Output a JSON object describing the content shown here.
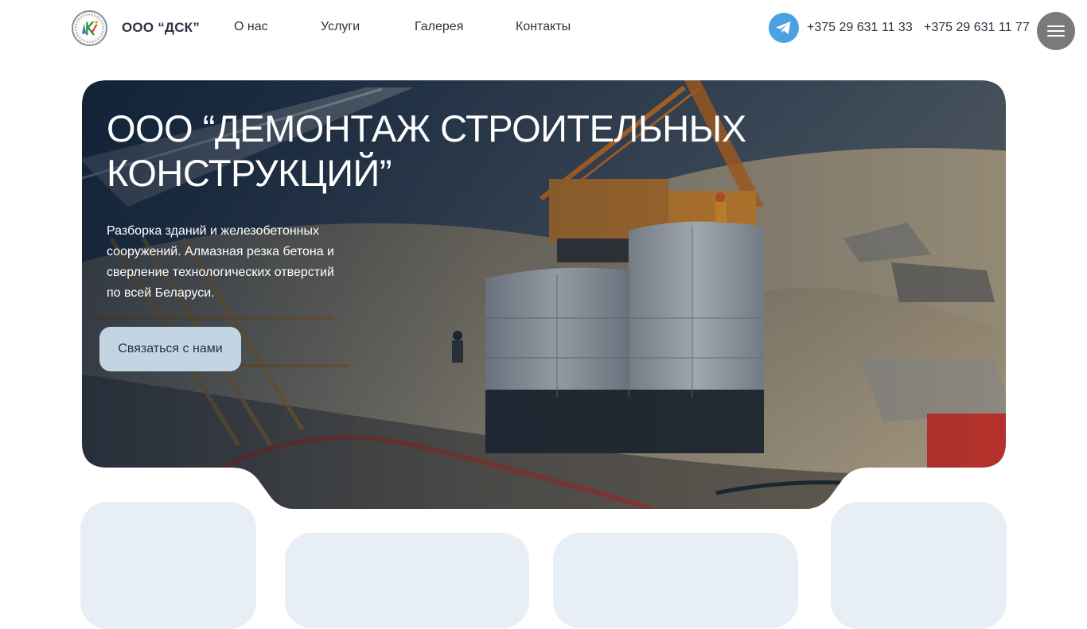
{
  "header": {
    "brand": "ООО “ДСК”",
    "nav": [
      {
        "label": "О нас"
      },
      {
        "label": "Услуги"
      },
      {
        "label": "Галерея"
      },
      {
        "label": "Контакты"
      }
    ],
    "phones": [
      "+375 29 631 11 33",
      "+375 29 631 11 77"
    ],
    "icons": {
      "logo": "dsk-logo-icon",
      "messenger": "telegram-icon",
      "menu": "hamburger-menu-icon"
    },
    "telegram_color": "#4aa2e0",
    "menu_button_color": "#7a7a7a"
  },
  "hero": {
    "title": "ООО “ДЕМОНТАЖ СТРОИТЕЛЬНЫХ КОНСТРУКЦИЙ”",
    "description": "Разборка зданий и железобетонных сооружений. Алмазная резка бетона и сверление технологических отверстий по всей Беларуси.",
    "cta_label": "Связаться с нами",
    "cta_color": "#c3d4e2",
    "image_subject": "construction-site-photo"
  },
  "cards": {
    "color": "#e8eef5",
    "count": 4
  }
}
